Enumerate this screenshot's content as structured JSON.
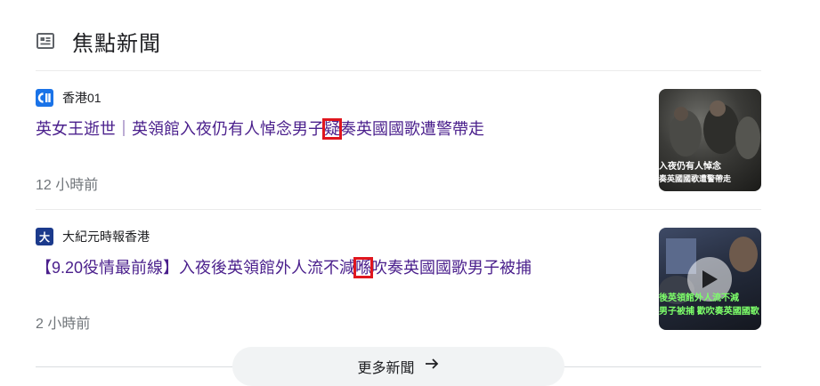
{
  "header": {
    "title": "焦點新聞",
    "icon": "newspaper-icon"
  },
  "articles": [
    {
      "source": "香港01",
      "source_logo_color": "#1a73e8",
      "source_logo_text": "01",
      "headline_pre": "英女王逝世｜英領館入夜仍有人悼念男子",
      "headline_mark": "疑",
      "headline_post": "奏英國國歌遭警帶走",
      "time": "12 小時前",
      "thumb_caption_1": "入夜仍有人悼念",
      "thumb_caption_2": "奏英國國歌遭警帶走"
    },
    {
      "source": "大紀元時報香港",
      "source_logo_color": "#1b3a8c",
      "source_logo_text": "大",
      "headline_pre": "【9.20役情最前線】入夜後英領館外人流不減",
      "headline_mark": "喺",
      "headline_post": "吹奏英國國歌男子被捕",
      "time": "2 小時前",
      "thumb_caption_1": "後英領館外人流不減",
      "thumb_caption_2": "男子被捕 歡吹奏英國國歌"
    }
  ],
  "more_button": {
    "label": "更多新聞"
  },
  "colors": {
    "headline": "#4a1f8c",
    "highlight_box": "#e0161e",
    "divider": "#ebebeb"
  }
}
